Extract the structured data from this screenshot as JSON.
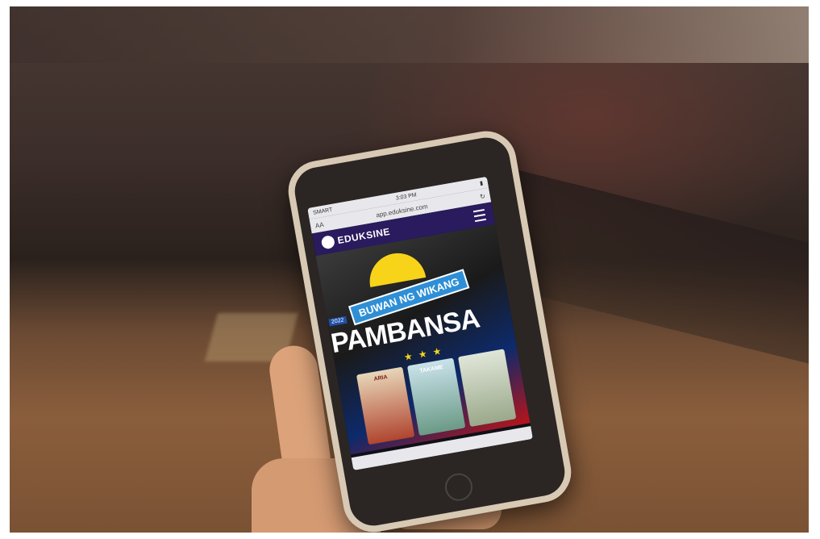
{
  "phone": {
    "status": {
      "carrier": "SMART",
      "time": "3:03 PM",
      "battery": ""
    },
    "browser": {
      "text_size": "AA",
      "url": "app.eduksine.com",
      "reload_icon": "reload-icon"
    },
    "site": {
      "logo_text": "EDUKSINE",
      "menu_icon": "hamburger-menu-icon",
      "hero": {
        "banner": "BUWAN NG WIKANG",
        "year": "2022",
        "headline": "PAMBANSA",
        "stars": "★ ★ ★"
      },
      "posters": [
        {
          "title": "ARIA"
        },
        {
          "title": "TAKAME"
        },
        {
          "title": ""
        }
      ]
    }
  }
}
